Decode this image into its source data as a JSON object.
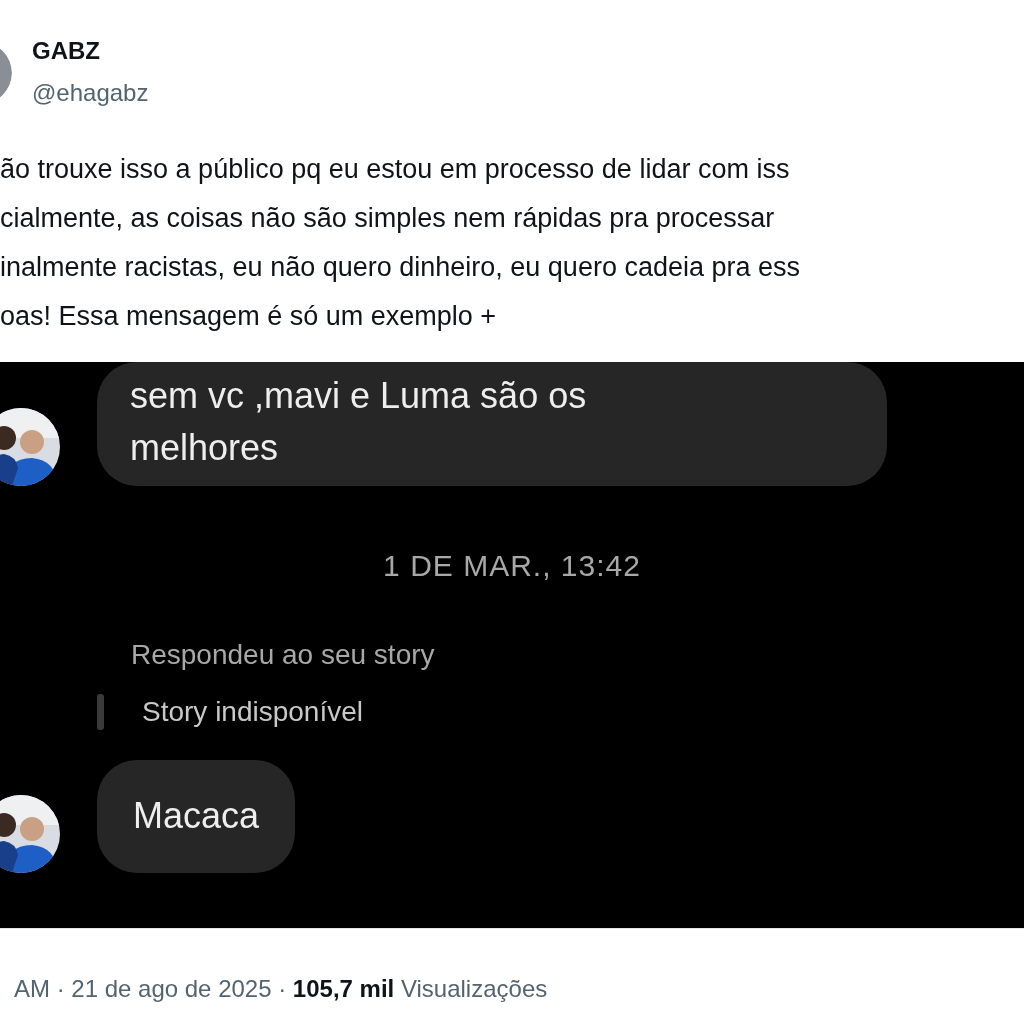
{
  "author": {
    "name": "GABZ",
    "handle": "@ehagabz"
  },
  "tweet": {
    "lines": [
      "ão trouxe isso a público pq eu estou em processo de lidar com iss",
      "cialmente, as coisas não são simples nem rápidas pra processar",
      "inalmente racistas, eu não quero dinheiro, eu quero cadeia pra ess",
      "oas! Essa mensagem é só um exemplo +"
    ]
  },
  "media": {
    "messages": [
      {
        "kind": "incoming",
        "lines": [
          "sem vc ,mavi e Luma são os",
          "melhores"
        ]
      },
      {
        "kind": "timestamp",
        "text": "1 DE MAR., 13:42"
      },
      {
        "kind": "story_reply",
        "label": "Respondeu ao seu story",
        "story": "Story indisponível"
      },
      {
        "kind": "incoming",
        "lines": [
          "Macaca"
        ]
      }
    ]
  },
  "footer": "AM · 21 de ago de 2025 · **105,7 mil** Visualizações"
}
